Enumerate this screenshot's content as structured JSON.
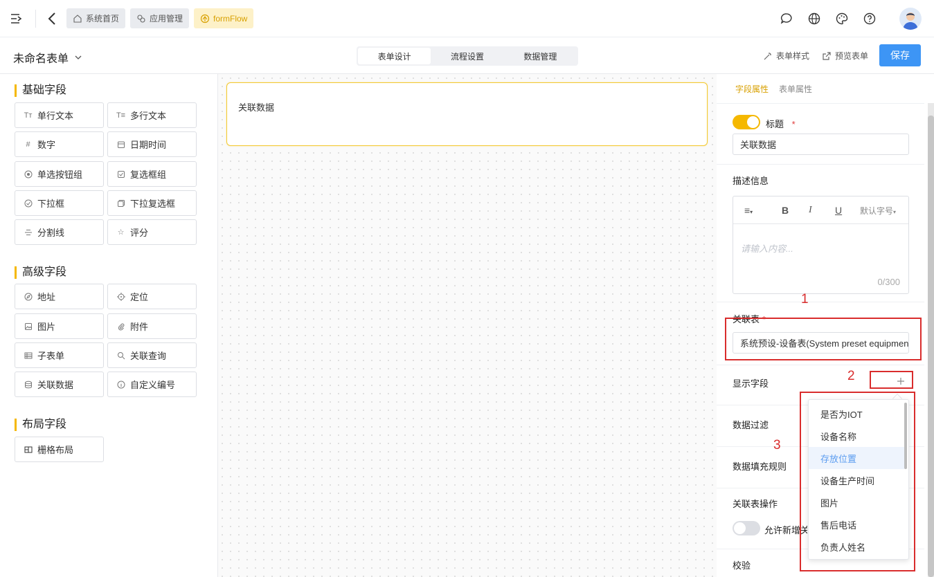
{
  "topbar": {
    "tabs": [
      {
        "label": "系统首页",
        "icon": "home-icon"
      },
      {
        "label": "应用管理",
        "icon": "app-icon"
      },
      {
        "label": "formFlow",
        "icon": "flow-icon",
        "active": true
      }
    ],
    "right_icons": [
      "message-icon",
      "globe-icon",
      "palette-icon",
      "help-icon",
      "avatar"
    ]
  },
  "header": {
    "form_name": "未命名表单",
    "segments": [
      {
        "label": "表单设计",
        "active": true
      },
      {
        "label": "流程设置"
      },
      {
        "label": "数据管理"
      }
    ],
    "style_label": "表单样式",
    "preview_label": "预览表单",
    "save_label": "保存"
  },
  "left": {
    "basic_title": "基础字段",
    "basic_fields": [
      {
        "label": "单行文本",
        "icon": "text-icon"
      },
      {
        "label": "多行文本",
        "icon": "multiline-text-icon"
      },
      {
        "label": "数字",
        "icon": "hash-icon"
      },
      {
        "label": "日期时间",
        "icon": "calendar-icon"
      },
      {
        "label": "单选按钮组",
        "icon": "radio-icon"
      },
      {
        "label": "复选框组",
        "icon": "checkbox-icon"
      },
      {
        "label": "下拉框",
        "icon": "dropdown-icon"
      },
      {
        "label": "下拉复选框",
        "icon": "multi-dropdown-icon"
      },
      {
        "label": "分割线",
        "icon": "divider-icon"
      },
      {
        "label": "评分",
        "icon": "star-icon"
      }
    ],
    "advanced_title": "高级字段",
    "advanced_fields": [
      {
        "label": "地址",
        "icon": "compass-icon"
      },
      {
        "label": "定位",
        "icon": "location-icon"
      },
      {
        "label": "图片",
        "icon": "image-icon"
      },
      {
        "label": "附件",
        "icon": "paperclip-icon"
      },
      {
        "label": "子表单",
        "icon": "table-icon"
      },
      {
        "label": "关联查询",
        "icon": "search-icon"
      },
      {
        "label": "关联数据",
        "icon": "database-icon"
      },
      {
        "label": "自定义编号",
        "icon": "info-icon"
      }
    ],
    "layout_title": "布局字段",
    "layout_fields": [
      {
        "label": "栅格布局",
        "icon": "grid-icon"
      }
    ]
  },
  "canvas": {
    "card_label": "关联数据"
  },
  "right": {
    "tab_field": "字段属性",
    "tab_form": "表单属性",
    "title_label": "标题",
    "title_toggle_on": true,
    "title_value": "关联数据",
    "desc_label": "描述信息",
    "editor_font": "默认字号",
    "editor_placeholder": "请输入内容...",
    "editor_counter": "0/300",
    "assoc_table_label": "关联表",
    "assoc_table_value": "系统预设-设备表(System preset equipment)",
    "display_fields_label": "显示字段",
    "data_filter_label": "数据过滤",
    "fill_rule_label": "数据填充规则",
    "assoc_ops_label": "关联表操作",
    "allow_new_label": "允许新增关联",
    "allow_new_toggle_on": false,
    "validation_label": "校验"
  },
  "dropdown": {
    "items": [
      {
        "label": "是否为IOT"
      },
      {
        "label": "设备名称"
      },
      {
        "label": "存放位置",
        "highlighted": true
      },
      {
        "label": "设备生产时间"
      },
      {
        "label": "图片"
      },
      {
        "label": "售后电话"
      },
      {
        "label": "负责人姓名"
      }
    ]
  },
  "annotations": [
    "1",
    "2",
    "3"
  ],
  "colors": {
    "accent": "#f5b800",
    "primary": "#3d95f5",
    "annotation": "#d92c2c"
  }
}
